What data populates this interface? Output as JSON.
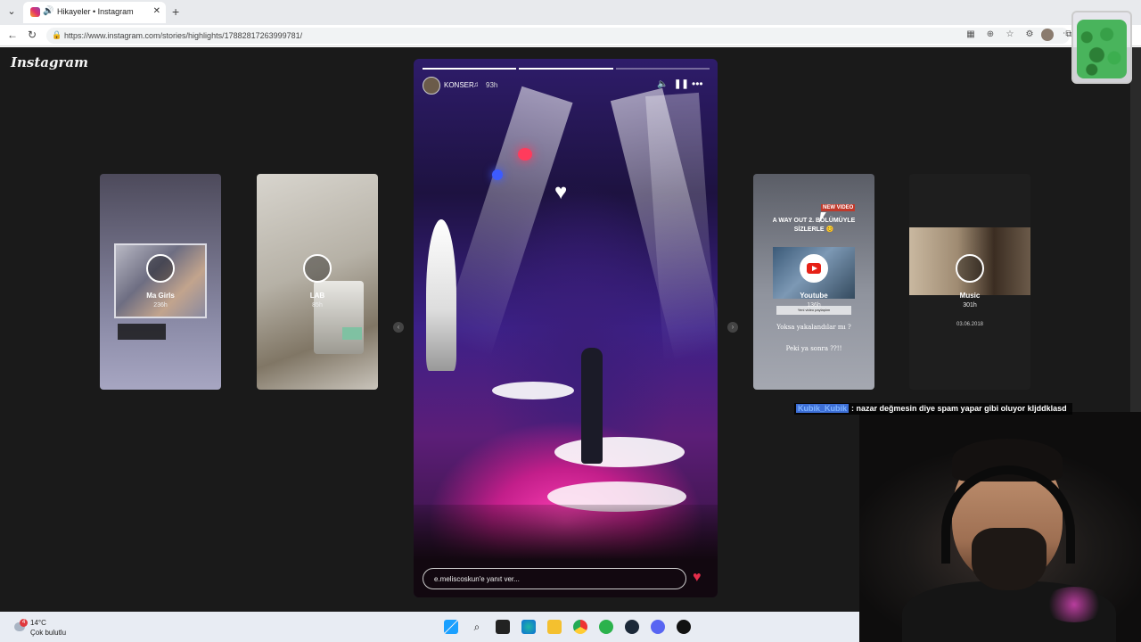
{
  "browser": {
    "tab_title": "Hikayeler • Instagram",
    "url": "https://www.instagram.com/stories/highlights/17882817263999781/"
  },
  "instagram": {
    "logo": "Instagram",
    "story": {
      "username": "KONSER",
      "time_ago": "93h",
      "reply_placeholder": "e.meliscoskun'e yanıt ver..."
    },
    "highlights": [
      {
        "name": "Ma Girls",
        "time": "236h"
      },
      {
        "name": "LAB",
        "time": "85h"
      },
      {
        "name": "Youtube",
        "time": "136h",
        "new_video": "NEW VIDEO",
        "headline": "A WAY OUT 2. BÖLÜMÜYLE SİZLERLE 😊",
        "tag": "Yeni video paylaştım",
        "question1": "Yoksa yakalandılar mı ?",
        "question2": "Peki ya sonra ??!!"
      },
      {
        "name": "Music",
        "time": "301h",
        "date": "03.06.2018"
      }
    ]
  },
  "taskbar": {
    "temperature": "14°C",
    "condition": "Çok bulutlu",
    "weather_badge": "4"
  },
  "chat_overlay": {
    "user": "Kubik_Kubik",
    "message": ": nazar değmesin diye spam yapar gibi oluyor kljddklasd"
  }
}
